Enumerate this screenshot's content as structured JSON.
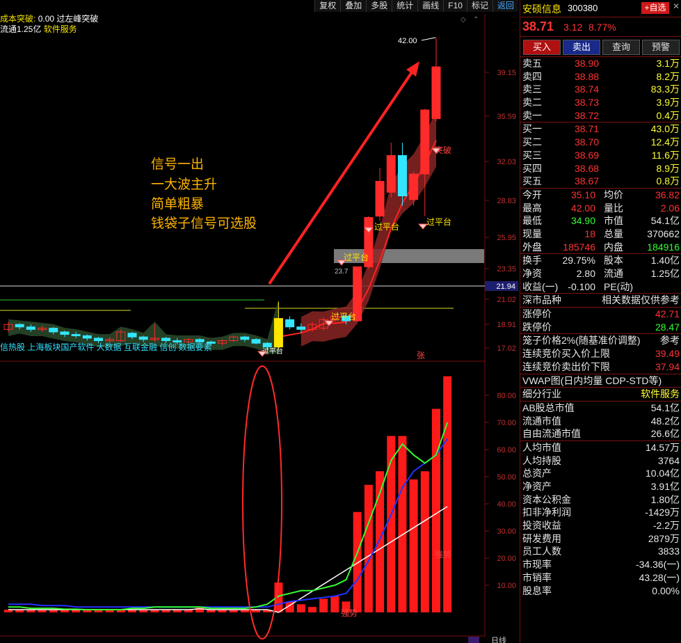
{
  "toolbar": {
    "items": [
      "复权",
      "叠加",
      "多股",
      "统计",
      "画线",
      "F10",
      "标记",
      "返回"
    ]
  },
  "info": {
    "line1_label": "成本突破:",
    "line1_val": "0.00",
    "line1_tag": "过左峰突破",
    "line2_label": "流通1.25亿",
    "line2_tag": "软件服务"
  },
  "annot": {
    "l1": "信号一出",
    "l2": "一大波主升",
    "l3": "简单粗暴",
    "l4": "钱袋子信号可选股"
  },
  "concepts": "信热股 上海板块国产软件 大数据 互联金融 信创 数据要素",
  "markers": {
    "high": "42.00",
    "cross_value": "21.94",
    "pt1": "过平台",
    "pt2": "过平台",
    "pt3": "过平台",
    "pt4": "过平台",
    "breakout": "突破",
    "low_lbl": "23.7",
    "bottom_lbl": "过平台",
    "zhang": "张",
    "strong1": "强势",
    "strong2": "强势",
    "right_label": "日线"
  },
  "axis_upper": [
    "39.15",
    "35.59",
    "32.03",
    "28.83",
    "25.95",
    "23.35",
    "21.02",
    "18.91",
    "17.02"
  ],
  "axis_lower": [
    "80.00",
    "70.00",
    "60.00",
    "50.00",
    "40.00",
    "30.00",
    "20.00",
    "10.00"
  ],
  "stock": {
    "name": "安硕信息",
    "code": "300380",
    "add": "+自选",
    "price": "38.71",
    "change": "3.12",
    "pct": "8.77%"
  },
  "trade_buttons": [
    "买入",
    "卖出",
    "查询",
    "预警"
  ],
  "asks": [
    {
      "l": "卖五",
      "p": "38.90",
      "v": "3.1万"
    },
    {
      "l": "卖四",
      "p": "38.88",
      "v": "8.2万"
    },
    {
      "l": "卖三",
      "p": "38.74",
      "v": "83.3万"
    },
    {
      "l": "卖二",
      "p": "38.73",
      "v": "3.9万"
    },
    {
      "l": "卖一",
      "p": "38.72",
      "v": "0.4万"
    }
  ],
  "bids": [
    {
      "l": "买一",
      "p": "38.71",
      "v": "43.0万"
    },
    {
      "l": "买二",
      "p": "38.70",
      "v": "12.4万"
    },
    {
      "l": "买三",
      "p": "38.69",
      "v": "11.6万"
    },
    {
      "l": "买四",
      "p": "38.68",
      "v": "8.9万"
    },
    {
      "l": "买五",
      "p": "38.67",
      "v": "0.8万"
    }
  ],
  "stats": [
    {
      "l": "今开",
      "v": "35.10",
      "l2": "均价",
      "v2": "36.82"
    },
    {
      "l": "最高",
      "v": "42.00",
      "l2": "量比",
      "v2": "2.06"
    },
    {
      "l": "最低",
      "v": "34.90",
      "l2": "市值",
      "v2": "54.1亿"
    },
    {
      "l": "现量",
      "v": "18",
      "l2": "总量",
      "v2": "370662"
    },
    {
      "l": "外盘",
      "v": "185746",
      "l2": "内盘",
      "v2": "184916"
    }
  ],
  "stats2": [
    {
      "l": "换手",
      "v": "29.75%",
      "l2": "股本",
      "v2": "1.40亿"
    },
    {
      "l": "净资",
      "v": "2.80",
      "l2": "流通",
      "v2": "1.25亿"
    },
    {
      "l": "收益(一)",
      "v": "-0.100",
      "l2": "PE(动)",
      "v2": ""
    }
  ],
  "sec1": {
    "title": "深市品种",
    "right": "相关数据仅供参考"
  },
  "limits": [
    {
      "l": "涨停价",
      "v": "42.71"
    },
    {
      "l": "跌停价",
      "v": "28.47"
    }
  ],
  "cage": {
    "title": "笼子价格2%(随基准价调整)",
    "right": "参考",
    "r1l": "连续竞价买入价上限",
    "r1v": "39.49",
    "r2l": "连续竞价卖出价下限",
    "r2v": "37.94"
  },
  "vwap": "VWAP图(日内均量 CDP-STD等)",
  "fund": [
    {
      "l": "细分行业",
      "v": "软件服务"
    },
    {
      "l": "AB股总市值",
      "v": "54.1亿"
    },
    {
      "l": "流通市值",
      "v": "48.2亿"
    },
    {
      "l": "自由流通市值",
      "v": "26.6亿"
    },
    {
      "l": "人均市值",
      "v": "14.57万"
    },
    {
      "l": "人均持股",
      "v": "3764"
    },
    {
      "l": "总资产",
      "v": "10.04亿"
    },
    {
      "l": "净资产",
      "v": "3.91亿"
    },
    {
      "l": "资本公积金",
      "v": "1.80亿"
    },
    {
      "l": "扣非净利润",
      "v": "-1429万"
    },
    {
      "l": "投资收益",
      "v": "-2.2万"
    },
    {
      "l": "研发费用",
      "v": "2879万"
    },
    {
      "l": "员工人数",
      "v": "3833"
    },
    {
      "l": "市现率",
      "v": "-34.36(一)"
    },
    {
      "l": "市销率",
      "v": "43.28(一)"
    },
    {
      "l": "股息率",
      "v": "0.00%"
    }
  ],
  "candles": [
    {
      "o": 18.5,
      "c": 18.9,
      "h": 19.1,
      "l": 18.3
    },
    {
      "o": 18.9,
      "c": 18.7,
      "h": 19.0,
      "l": 18.5
    },
    {
      "o": 18.7,
      "c": 18.5,
      "h": 18.9,
      "l": 18.3
    },
    {
      "o": 18.5,
      "c": 18.6,
      "h": 18.8,
      "l": 18.3
    },
    {
      "o": 18.6,
      "c": 18.3,
      "h": 18.7,
      "l": 18.1
    },
    {
      "o": 18.3,
      "c": 18.1,
      "h": 18.4,
      "l": 17.9
    },
    {
      "o": 18.1,
      "c": 18.0,
      "h": 18.3,
      "l": 17.8
    },
    {
      "o": 18.0,
      "c": 17.8,
      "h": 18.1,
      "l": 17.6
    },
    {
      "o": 17.8,
      "c": 17.6,
      "h": 17.9,
      "l": 17.4
    },
    {
      "o": 17.6,
      "c": 17.7,
      "h": 17.9,
      "l": 17.4
    },
    {
      "o": 17.6,
      "c": 18.3,
      "h": 18.5,
      "l": 17.5
    },
    {
      "o": 18.2,
      "c": 17.9,
      "h": 18.3,
      "l": 17.7
    },
    {
      "o": 17.9,
      "c": 17.7,
      "h": 18.0,
      "l": 17.5
    },
    {
      "o": 17.7,
      "c": 17.8,
      "h": 18.9,
      "l": 17.5
    },
    {
      "o": 17.8,
      "c": 17.6,
      "h": 17.9,
      "l": 17.4
    },
    {
      "o": 17.6,
      "c": 17.5,
      "h": 17.8,
      "l": 17.3
    },
    {
      "o": 17.5,
      "c": 17.7,
      "h": 17.8,
      "l": 17.3
    },
    {
      "o": 17.7,
      "c": 17.5,
      "h": 17.8,
      "l": 17.4
    },
    {
      "o": 17.5,
      "c": 17.4,
      "h": 17.6,
      "l": 17.2
    },
    {
      "o": 17.4,
      "c": 17.6,
      "h": 17.7,
      "l": 17.2
    },
    {
      "o": 17.6,
      "c": 17.9,
      "h": 18.0,
      "l": 17.5
    },
    {
      "o": 17.9,
      "c": 17.7,
      "h": 18.0,
      "l": 17.5
    },
    {
      "o": 17.7,
      "c": 17.4,
      "h": 17.8,
      "l": 17.3
    },
    {
      "o": 17.4,
      "c": 17.1,
      "h": 17.5,
      "l": 16.9
    },
    {
      "o": 17.1,
      "c": 19.4,
      "h": 20.8,
      "l": 16.9
    },
    {
      "o": 19.3,
      "c": 18.7,
      "h": 19.6,
      "l": 18.5
    },
    {
      "o": 18.7,
      "c": 18.5,
      "h": 19.0,
      "l": 18.2
    },
    {
      "o": 18.5,
      "c": 18.9,
      "h": 19.1,
      "l": 18.3
    },
    {
      "o": 18.6,
      "c": 19.3,
      "h": 19.5,
      "l": 18.4
    },
    {
      "o": 19.3,
      "c": 19.6,
      "h": 19.9,
      "l": 19.1
    },
    {
      "o": 19.6,
      "c": 19.2,
      "h": 19.8,
      "l": 18.9
    },
    {
      "o": 19.2,
      "c": 23.5,
      "h": 23.5,
      "l": 19.2
    },
    {
      "o": 23.5,
      "c": 27.5,
      "h": 27.6,
      "l": 23.3
    },
    {
      "o": 27.6,
      "c": 30.4,
      "h": 31.5,
      "l": 27.2
    },
    {
      "o": 29.5,
      "c": 32.5,
      "h": 33.5,
      "l": 29.1
    },
    {
      "o": 32.5,
      "c": 29.2,
      "h": 33.5,
      "l": 28.4
    },
    {
      "o": 28.9,
      "c": 31.0,
      "h": 31.2,
      "l": 28.4
    },
    {
      "o": 31.0,
      "c": 36.1,
      "h": 36.2,
      "l": 27.6
    },
    {
      "o": 35.4,
      "c": 39.6,
      "h": 42.0,
      "l": 35.2
    }
  ],
  "volume": [
    1,
    1,
    1,
    1,
    1,
    1,
    1,
    1,
    1,
    1,
    1,
    1,
    1,
    1,
    1,
    1,
    1,
    2,
    1,
    1,
    1,
    1,
    1,
    1,
    11,
    4,
    3,
    2,
    5,
    6,
    4,
    37,
    47,
    52,
    65,
    65,
    49,
    52,
    75,
    87
  ],
  "vol_ma_green": [
    2,
    2,
    1.5,
    1.5,
    1.5,
    1.2,
    1.2,
    1,
    1,
    1,
    1,
    1.5,
    1.5,
    2,
    2,
    2,
    2,
    2,
    1.5,
    1.5,
    1.5,
    1.5,
    2,
    3,
    6,
    7,
    8,
    8,
    9,
    10,
    12,
    22,
    33,
    44,
    56,
    62,
    58,
    55,
    58,
    70
  ],
  "vol_ma_blue": [
    3,
    3,
    3,
    2.5,
    2.5,
    2.5,
    2,
    2,
    2,
    2,
    2,
    2,
    2,
    2,
    2,
    2,
    2,
    2,
    2,
    2,
    2,
    2,
    2,
    2,
    3,
    4,
    4.5,
    5,
    5.5,
    6,
    7,
    12,
    19,
    27,
    36,
    46,
    52,
    55,
    58,
    64
  ]
}
